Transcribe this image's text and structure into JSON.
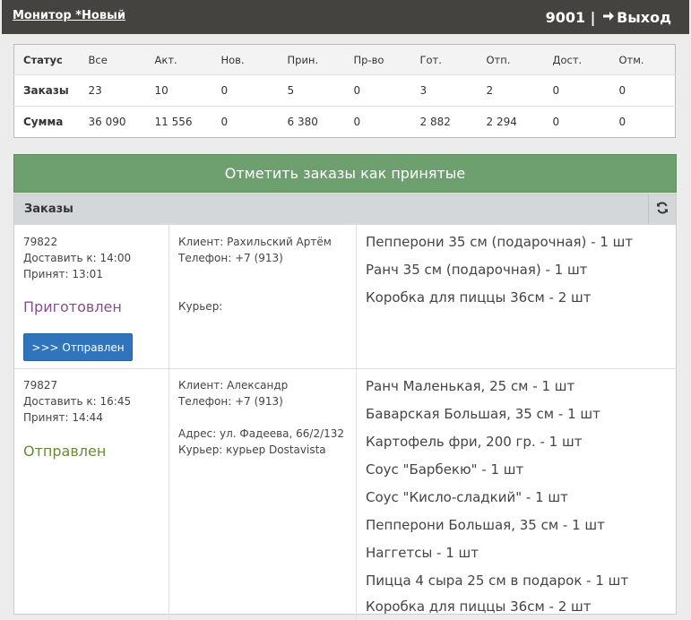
{
  "topbar": {
    "title": "Монитор *Новый",
    "user_id": "9001",
    "separator": "|",
    "logout_label": "Выход"
  },
  "stats": {
    "headers": [
      "Статус",
      "Все",
      "Акт.",
      "Нов.",
      "Прин.",
      "Пр-во",
      "Гот.",
      "Отп.",
      "Дост.",
      "Отм."
    ],
    "rows": [
      [
        "Заказы",
        "23",
        "10",
        "0",
        "5",
        "0",
        "3",
        "2",
        "0",
        "0"
      ],
      [
        "Сумма",
        "36 090",
        "11 556",
        "0",
        "6 380",
        "0",
        "2 882",
        "2 294",
        "0",
        "0"
      ]
    ]
  },
  "accept_button": "Отметить заказы как принятые",
  "orders_panel": {
    "title": "Заказы",
    "refresh_icon": "refresh-icon"
  },
  "orders": [
    {
      "id": "79822",
      "deliver": "Доставить к: 14:00",
      "accepted": "Принят: 13:01",
      "status": "Приготовлен",
      "action": ">>> Отправлен",
      "client": "Клиент: Рахильский Артём",
      "phone": "Телефон: +7 (913)",
      "address": "",
      "courier": "Курьер:",
      "items": [
        "Пепперони 35 см (подарочная) - 1 шт",
        "Ранч 35 см (подарочная) - 1 шт",
        "Коробка для пиццы 36см - 2 шт"
      ]
    },
    {
      "id": "79827",
      "deliver": "Доставить к: 16:45",
      "accepted": "Принят: 14:44",
      "status": "Отправлен",
      "client": "Клиент: Александр",
      "phone": "Телефон: +7 (913)",
      "address": "Адрес: ул. Фадеева, 66/2/132",
      "courier": "Курьер: курьер Dostavista",
      "items": [
        "Ранч Маленькая, 25 см - 1 шт",
        "Баварская Большая, 35 см - 1 шт",
        "Картофель фри, 200 гр. - 1 шт",
        "Соус \"Барбекю\" - 1 шт",
        "Соус \"Кисло-сладкий\" - 1 шт",
        "Пепперони Большая, 35 см - 1 шт",
        "Наггетсы - 1 шт",
        "Пицца 4 сыра 25 см в подарок - 1 шт",
        "Коробка для пиццы 36см - 2 шт"
      ]
    }
  ]
}
